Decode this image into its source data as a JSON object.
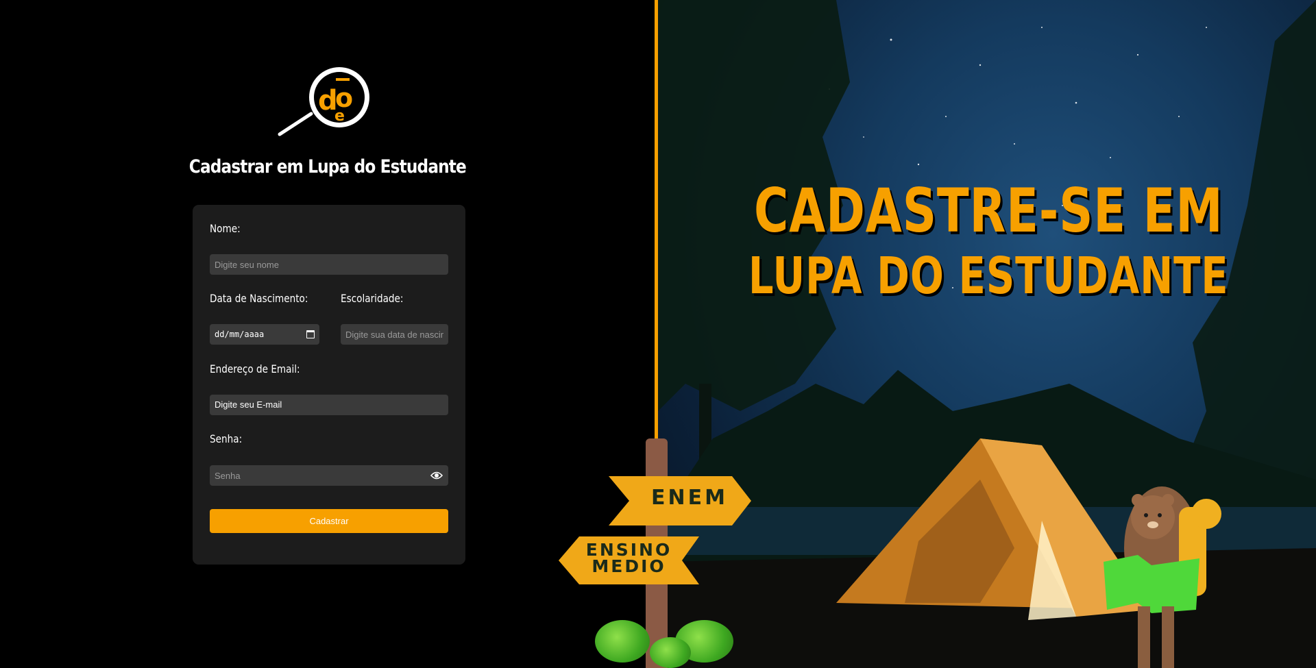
{
  "form": {
    "title": "Cadastrar em Lupa do Estudante",
    "name_label": "Nome:",
    "name_placeholder": "Digite seu nome",
    "birth_label": "Data de Nascimento:",
    "birth_value": "dd/mm/aaaa",
    "school_label": "Escolaridade:",
    "school_placeholder": "Digite sua data de nascimento",
    "email_label": "Endereço de Email:",
    "email_value": "Digite seu E-mail",
    "password_label": "Senha:",
    "password_placeholder": "Senha",
    "submit_label": "Cadastrar"
  },
  "hero": {
    "line1": "CADASTRE-SE EM",
    "line2": "LUPA DO ESTUDANTE"
  },
  "signs": {
    "enem": "ENEM",
    "ensino_line1": "ENSINO",
    "ensino_line2": "MEDIO"
  },
  "colors": {
    "accent": "#f7a000",
    "card": "#1c1c1c",
    "field": "#3a3a3a"
  },
  "icons": [
    "magnifier-logo-icon",
    "calendar-icon",
    "eye-icon"
  ]
}
